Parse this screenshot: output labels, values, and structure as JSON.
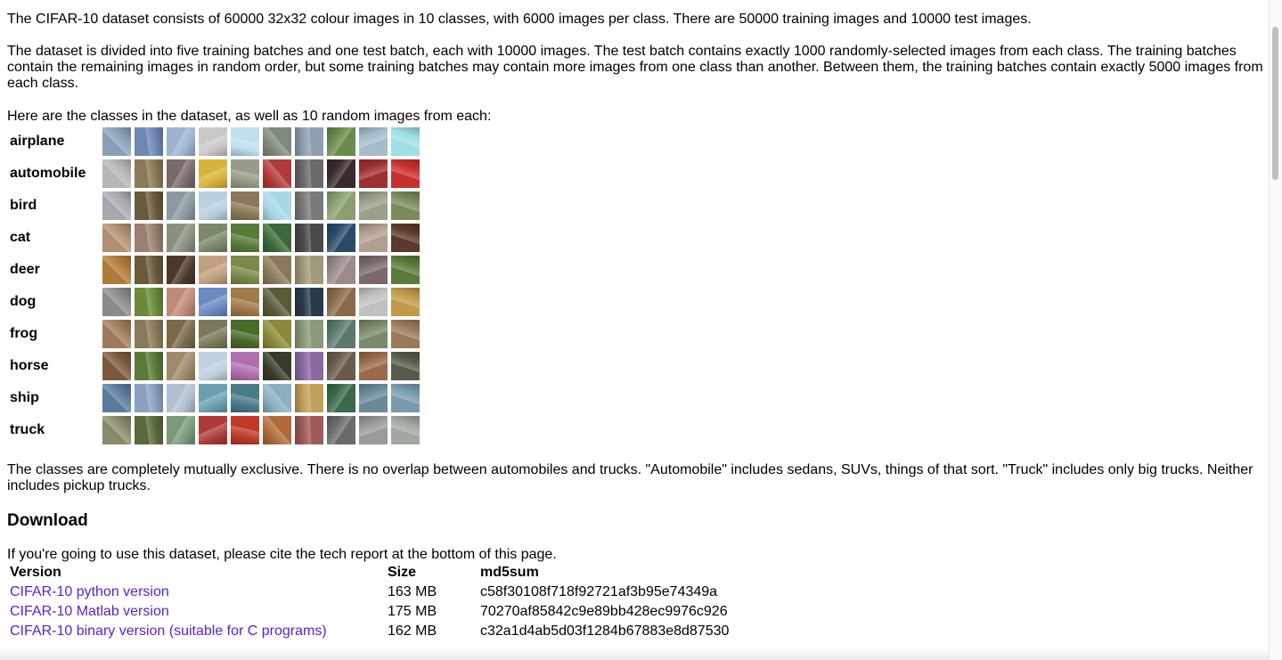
{
  "intro": {
    "paragraph1": "The CIFAR-10 dataset consists of 60000 32x32 colour images in 10 classes, with 6000 images per class. There are 50000 training images and 10000 test images.",
    "paragraph2": "The dataset is divided into five training batches and one test batch, each with 10000 images. The test batch contains exactly 1000 randomly-selected images from each class. The training batches contain the remaining images in random order, but some training batches may contain more images from one class than another. Between them, the training batches contain exactly 5000 images from each class.",
    "paragraph3": "Here are the classes in the dataset, as well as 10 random images from each:"
  },
  "classes": [
    {
      "name": "airplane",
      "colors": [
        "#8aa0b8",
        "#6f87b5",
        "#9db4cf",
        "#c9c9c9",
        "#bfe0ef",
        "#7f8a7a",
        "#8e9fb0",
        "#6a8a4e",
        "#a6bccc",
        "#9fe0e6"
      ]
    },
    {
      "name": "automobile",
      "colors": [
        "#b5b5b5",
        "#8a7a55",
        "#7a6a6a",
        "#d9b23a",
        "#9a9a8a",
        "#b23a3a",
        "#6a6a6a",
        "#3a2a2a",
        "#a03030",
        "#c83030"
      ]
    },
    {
      "name": "bird",
      "colors": [
        "#a8a8b0",
        "#6a5a3a",
        "#8a9aa0",
        "#b8d0e0",
        "#8a7a5a",
        "#a8d8e8",
        "#7a7a7a",
        "#8aa070",
        "#9aa08a",
        "#7a8a5a"
      ]
    },
    {
      "name": "cat",
      "colors": [
        "#b09070",
        "#9a8070",
        "#8a9080",
        "#7a8a6a",
        "#5a7a3a",
        "#3a6a3a",
        "#4a4a4a",
        "#2a4a6a",
        "#b0a090",
        "#5a3a2a"
      ]
    },
    {
      "name": "deer",
      "colors": [
        "#b07a3a",
        "#6a5a3a",
        "#4a3a2a",
        "#c0a080",
        "#7a8a4a",
        "#8a7a5a",
        "#a09a7a",
        "#9a8a8a",
        "#7a6a6a",
        "#5a7a3a"
      ]
    },
    {
      "name": "dog",
      "colors": [
        "#8a8a8a",
        "#6a8a3a",
        "#c08a7a",
        "#6a8ac0",
        "#a07a4a",
        "#5a5a3a",
        "#2a3a4a",
        "#8a6a4a",
        "#c0c0c0",
        "#c09a4a"
      ]
    },
    {
      "name": "frog",
      "colors": [
        "#a07a5a",
        "#8a7a5a",
        "#7a6a4a",
        "#7a7a5a",
        "#4a6a2a",
        "#8a8a3a",
        "#8a9a7a",
        "#5a7a6a",
        "#7a8a6a",
        "#9a7a5a"
      ]
    },
    {
      "name": "horse",
      "colors": [
        "#7a5a3a",
        "#5a7a3a",
        "#a08a6a",
        "#c0d0e0",
        "#b070b0",
        "#3a3a2a",
        "#8a6aa0",
        "#6a5a4a",
        "#9a6a4a",
        "#5a5a4a"
      ]
    },
    {
      "name": "ship",
      "colors": [
        "#5a7aa0",
        "#8aa0c0",
        "#b0c0d0",
        "#6aa0b0",
        "#4a7a8a",
        "#8ab0c0",
        "#c0a05a",
        "#3a6a4a",
        "#6a8a9a",
        "#7a9ab0"
      ]
    },
    {
      "name": "truck",
      "colors": [
        "#8a8a6a",
        "#5a6a3a",
        "#7a9a7a",
        "#b03a3a",
        "#c03a2a",
        "#b06a3a",
        "#a05a5a",
        "#6a6a6a",
        "#9a9a9a",
        "#a0a8a0"
      ]
    }
  ],
  "closing": {
    "paragraph": "The classes are completely mutually exclusive. There is no overlap between automobiles and trucks. \"Automobile\" includes sedans, SUVs, things of that sort. \"Truck\" includes only big trucks. Neither includes pickup trucks."
  },
  "download": {
    "heading": "Download",
    "cite_note": "If you're going to use this dataset, please cite the tech report at the bottom of this page.",
    "headers": {
      "version": "Version",
      "size": "Size",
      "md5": "md5sum"
    },
    "rows": [
      {
        "version": "CIFAR-10 python version",
        "size": "163 MB",
        "md5": "c58f30108f718f92721af3b95e74349a"
      },
      {
        "version": "CIFAR-10 Matlab version",
        "size": "175 MB",
        "md5": "70270af85842c9e89bb428ec9976c926"
      },
      {
        "version": "CIFAR-10 binary version (suitable for C programs)",
        "size": "162 MB",
        "md5": "c32a1d4ab5d03f1284b67883e8d87530"
      }
    ],
    "link_color": "#5a1fd1"
  }
}
